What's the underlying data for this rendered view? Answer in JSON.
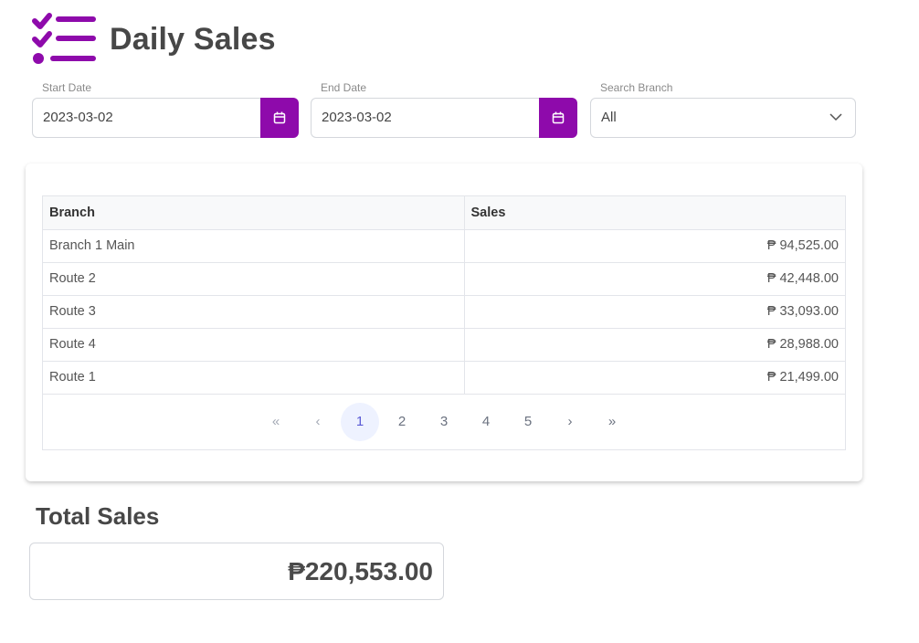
{
  "header": {
    "title": "Daily Sales",
    "icon": "checklist-icon",
    "accent_color": "#8e0aab"
  },
  "filters": {
    "start_date": {
      "label": "Start Date",
      "value": "2023-03-02",
      "icon": "calendar-icon"
    },
    "end_date": {
      "label": "End Date",
      "value": "2023-03-02",
      "icon": "calendar-icon"
    },
    "branch": {
      "label": "Search Branch",
      "value": "All",
      "icon": "chevron-down-icon"
    }
  },
  "table": {
    "columns": [
      "Branch",
      "Sales"
    ],
    "rows": [
      {
        "branch": "Branch 1 Main",
        "sales": "₱ 94,525.00"
      },
      {
        "branch": "Route 2",
        "sales": "₱ 42,448.00"
      },
      {
        "branch": "Route 3",
        "sales": "₱ 33,093.00"
      },
      {
        "branch": "Route 4",
        "sales": "₱ 28,988.00"
      },
      {
        "branch": "Route 1",
        "sales": "₱ 21,499.00"
      }
    ]
  },
  "pagination": {
    "first": "«",
    "prev": "‹",
    "pages": [
      "1",
      "2",
      "3",
      "4",
      "5"
    ],
    "current": "1",
    "next": "›",
    "last": "»"
  },
  "total": {
    "title": "Total Sales",
    "value": "₱220,553.00"
  }
}
